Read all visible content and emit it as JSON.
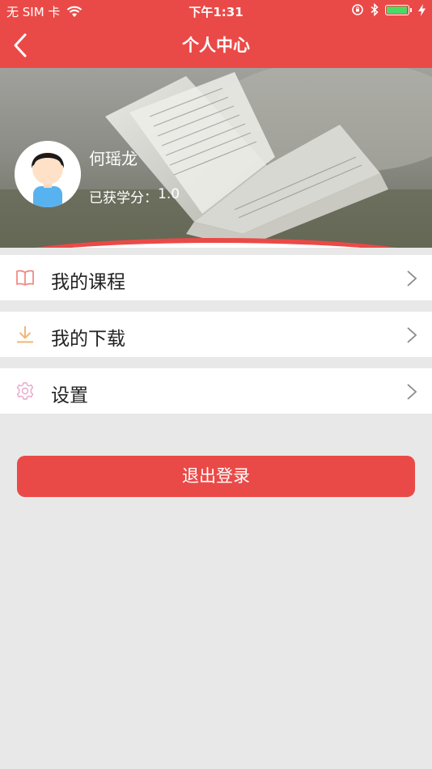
{
  "status_bar": {
    "carrier": "无 SIM 卡",
    "time": "下午1:31"
  },
  "nav": {
    "title": "个人中心"
  },
  "profile": {
    "name": "何瑶龙",
    "credit_label": "已获学分：",
    "credit_value": "1.0"
  },
  "menu": [
    {
      "label": "我的课程",
      "icon": "book-icon",
      "color": "#f08c84"
    },
    {
      "label": "我的下载",
      "icon": "download-icon",
      "color": "#f1b676"
    },
    {
      "label": "设置",
      "icon": "gear-icon",
      "color": "#e9a7c8"
    }
  ],
  "logout": {
    "label": "退出登录"
  },
  "colors": {
    "accent": "#ea4a47",
    "background": "#e8e8e8"
  }
}
